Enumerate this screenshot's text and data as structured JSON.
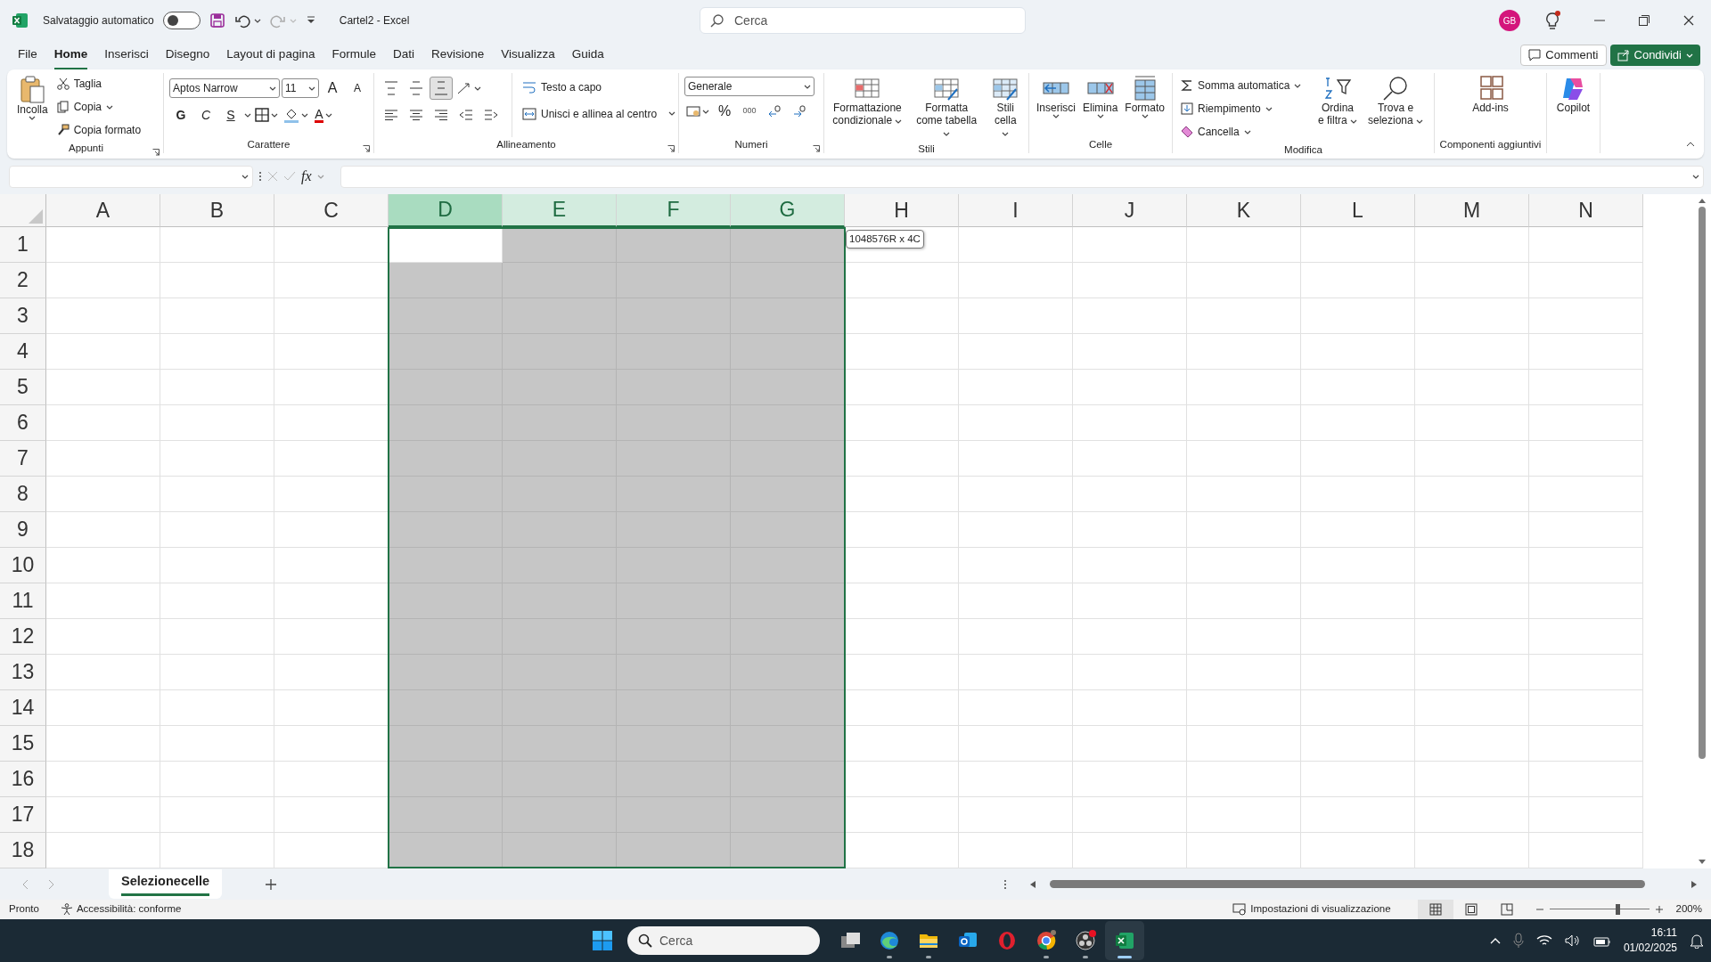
{
  "title_bar": {
    "autosave_label": "Salvataggio automatico",
    "autosave": {
      "on": false
    },
    "document_title": "Cartel2 - Excel",
    "search": {
      "placeholder": "Cerca"
    },
    "avatar": "GB"
  },
  "menu_tabs": [
    {
      "label": "File",
      "selected": false
    },
    {
      "label": "Home",
      "selected": true
    },
    {
      "label": "Inserisci",
      "selected": false
    },
    {
      "label": "Disegno",
      "selected": false
    },
    {
      "label": "Layout di pagina",
      "selected": false
    },
    {
      "label": "Formule",
      "selected": false
    },
    {
      "label": "Dati",
      "selected": false
    },
    {
      "label": "Revisione",
      "selected": false
    },
    {
      "label": "Visualizza",
      "selected": false
    },
    {
      "label": "Guida",
      "selected": false
    }
  ],
  "share_buttons": [
    {
      "label": "Commenti",
      "kind": "outline"
    },
    {
      "label": "Condividi",
      "kind": "primary"
    }
  ],
  "ribbon": {
    "clipboard": {
      "label": "Appunti",
      "paste": "Incolla",
      "cut": "Taglia",
      "copy": "Copia",
      "format_painter": "Copia formato"
    },
    "font": {
      "label": "Carattere",
      "font_name": "Aptos Narrow",
      "font_size": "11",
      "grow": "A",
      "shrink": "A",
      "bold": "G",
      "italic": "C",
      "underline": "S",
      "font_color": "A"
    },
    "alignment": {
      "label": "Allineamento",
      "vertical": [
        {
          "selected": false
        },
        {
          "selected": false
        },
        {
          "selected": true
        }
      ],
      "wrap_text": "Testo a capo",
      "merge": "Unisci e allinea al centro"
    },
    "number": {
      "label": "Numeri",
      "format": "Generale",
      "percent": "%",
      "thousands": "000"
    },
    "styles": {
      "label": "Stili",
      "buttons": [
        "Formattazione condizionale",
        "Formatta come tabella",
        "Stili cella"
      ]
    },
    "cells": {
      "label": "Celle",
      "buttons": [
        "Inserisci",
        "Elimina",
        "Formato"
      ]
    },
    "editing": {
      "label": "Modifica",
      "small": [
        "Somma automatica",
        "Riempimento",
        "Cancella"
      ],
      "large": [
        "Ordina e filtra",
        "Trova e seleziona"
      ]
    },
    "addins": {
      "label": "Componenti aggiuntivi",
      "button": "Add-ins"
    },
    "copilot": {
      "button": "Copilot"
    }
  },
  "formula_bar": {
    "function_label": "fx"
  },
  "columns": [
    {
      "letter": "A",
      "selected": false,
      "active": false
    },
    {
      "letter": "B",
      "selected": false,
      "active": false
    },
    {
      "letter": "C",
      "selected": false,
      "active": false
    },
    {
      "letter": "D",
      "selected": true,
      "active": true
    },
    {
      "letter": "E",
      "selected": true,
      "active": false
    },
    {
      "letter": "F",
      "selected": true,
      "active": false
    },
    {
      "letter": "G",
      "selected": true,
      "active": false
    },
    {
      "letter": "H",
      "selected": false,
      "active": false
    },
    {
      "letter": "I",
      "selected": false,
      "active": false
    },
    {
      "letter": "J",
      "selected": false,
      "active": false
    },
    {
      "letter": "K",
      "selected": false,
      "active": false
    },
    {
      "letter": "L",
      "selected": false,
      "active": false
    },
    {
      "letter": "M",
      "selected": false,
      "active": false
    },
    {
      "letter": "N",
      "selected": false,
      "active": false
    }
  ],
  "rows": [
    "1",
    "2",
    "3",
    "4",
    "5",
    "6",
    "7",
    "8",
    "9",
    "10",
    "11",
    "12",
    "13",
    "14",
    "15",
    "16",
    "17",
    "18"
  ],
  "selection_tooltip": "1048576R x 4C",
  "sheet_tabs": [
    {
      "label": "Selezionecelle",
      "selected": true
    }
  ],
  "status_bar": {
    "ready": "Pronto",
    "accessibility": "Accessibilità: conforme",
    "display_settings": "Impostazioni di visualizzazione",
    "views": [
      {
        "selected": true
      },
      {
        "selected": false
      },
      {
        "selected": false
      }
    ],
    "zoom": {
      "level": 0.68
    },
    "zoom_label": "200%"
  },
  "taskbar": {
    "search": {
      "placeholder": "Cerca"
    },
    "apps": [
      {
        "running": false,
        "selected": false
      },
      {
        "running": true,
        "selected": false
      },
      {
        "running": true,
        "selected": false
      },
      {
        "running": false,
        "selected": false
      },
      {
        "running": false,
        "selected": false
      },
      {
        "running": true,
        "selected": false
      },
      {
        "running": true,
        "selected": false
      },
      {
        "running": true,
        "selected": true
      }
    ],
    "time": "16:11",
    "date": "01/02/2025"
  }
}
